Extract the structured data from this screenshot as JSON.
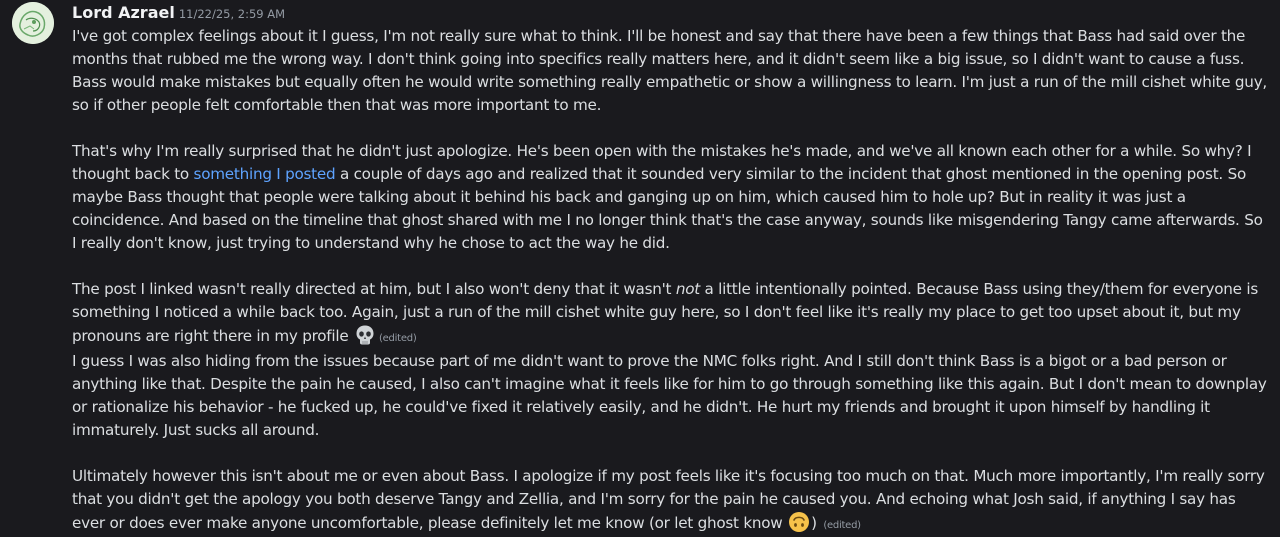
{
  "message": {
    "author": "Lord Azrael",
    "timestamp": "11/22/25, 2:59 AM",
    "block1": {
      "p1": "I've got complex feelings about it I guess, I'm not really sure what to think. I'll be honest and say that there have been a few things that Bass had said over the months that rubbed me the wrong way. I don't think going into specifics really matters here, and it didn't seem like a big issue, so I didn't want to cause a fuss. Bass would make mistakes but equally often he would write something really empathetic or show a willingness to learn. I'm just a run of the mill cishet white guy, so if other people felt comfortable then that was more important to me.",
      "p2_before": "That's why I'm really surprised that he didn't just apologize. He's been open with the mistakes he's made, and we've all known each other for a while. So why? I thought back to ",
      "p2_link": "something I posted",
      "p2_after": " a couple of days ago and realized that it sounded very similar to the incident that ghost mentioned in the opening post. So maybe Bass thought that people were talking about it behind his back and ganging up on him, which caused him to hole up? But in reality it was just a coincidence. And based on the timeline that ghost shared with me I no longer think that's the case anyway, sounds like misgendering Tangy came afterwards. So I really don't know, just trying to understand why he chose to act the way he did.",
      "p3_before": "The post I linked wasn't really directed at him, but I also won't deny that it wasn't ",
      "p3_em": "not",
      "p3_after": " a little intentionally pointed. Because Bass using they/them for everyone is something I noticed a while back too. Again, just a run of the mill cishet white guy here, so I don't feel like it's really my place to get too upset about it, but my pronouns are right there in my profile",
      "emoji": "skull-emoji",
      "edited": "(edited)"
    },
    "block2": {
      "p1": "I guess I was also hiding from the issues because part of me didn't want to prove the NMC folks right. And I still don't think Bass is a bigot or a bad person or anything like that. Despite the pain he caused, I also can't imagine what it feels like for him to go through something like this again. But I don't mean to downplay or rationalize his behavior - he fucked up, he could've fixed it relatively easily, and he didn't. He hurt my friends and brought it upon himself by handling it immaturely. Just sucks all around.",
      "p2": "Ultimately however this isn't about me or even about Bass. I apologize if my post feels like it's focusing too much on that. Much more importantly, I'm really sorry that you didn't get the apology you both deserve Tangy and Zellia, and I'm sorry for the pain he caused you. And echoing what Josh said, if anything I say has ever or does ever make anyone uncomfortable, please definitely let me know (or let ghost know",
      "p2_close": ")",
      "emoji": "upside-down-face-emoji",
      "edited": "(edited)"
    }
  },
  "colors": {
    "background": "#1a1a1e",
    "text": "#dbdee1",
    "username": "#f2f3f5",
    "muted": "#949ba4",
    "link": "#5ea3ff"
  }
}
